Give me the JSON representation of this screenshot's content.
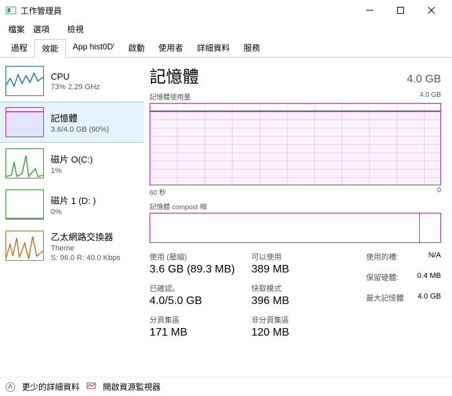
{
  "window": {
    "title": "工作管理員",
    "menu": {
      "file": "檔案",
      "options": "選項",
      "view": "檢視"
    }
  },
  "tabs": {
    "processes": "過程",
    "performance": "效能",
    "apphistory": "App hist0D'",
    "startup": "啟動",
    "users": "使用者",
    "details": "詳細資料",
    "services": "服務"
  },
  "sidebar": {
    "cpu": {
      "name": "CPU",
      "value": "73% 2.29 GHz"
    },
    "memory": {
      "name": "記憶體",
      "value": "3.6/4.0 GB (90%)"
    },
    "disk0": {
      "name": "磁片 O(C:)",
      "value": "1%"
    },
    "disk1": {
      "name": "磁片 1 (D: )",
      "value": "0%"
    },
    "eth": {
      "name": "乙太網路交換器",
      "sub": "Theme",
      "value": "S: 96.0 R: 40.0 Kbps"
    }
  },
  "main": {
    "title": "記憶體",
    "capacity": "4.0 GB",
    "chart1": {
      "label": "記憶體使用量",
      "max": "4.0 GB",
      "xleft": "60 秒",
      "xright": "0"
    },
    "chart2": {
      "label": "記憶體 compost 噸"
    },
    "stats": {
      "inuse_label": "使用 (壓縮)",
      "inuse_value": "3.6 GB (89.3 MB)",
      "available_label": "可以使用",
      "available_value": "389 MB",
      "committed_label": "已確認。",
      "committed_value": "4.0/5.0 GB",
      "cached_label": "快取模式",
      "cached_value": "396 MB",
      "paged_label": "分頁集區",
      "paged_value": "171 MB",
      "nonpaged_label": "非分頁集區",
      "nonpaged_value": "120 MB"
    },
    "right": {
      "slots_label": "使用的槽:",
      "slots_value": "N/A",
      "reserved_label": "保留硬體:",
      "reserved_value": "0.4 MB",
      "max_label": "最大記憶體",
      "max_value": "4.0 GB"
    }
  },
  "footer": {
    "fewer": "更少的詳細資料",
    "resmon": "開啟資源監視器"
  },
  "chart_data": {
    "type": "line",
    "title": "記憶體使用量",
    "xlabel": "秒",
    "ylabel": "GB",
    "x_range": [
      60,
      0
    ],
    "ylim": [
      0,
      4.0
    ],
    "series": [
      {
        "name": "記憶體",
        "values": [
          3.6,
          3.6,
          3.6,
          3.6,
          3.6,
          3.6,
          3.6,
          3.6,
          3.6,
          3.6,
          3.6,
          3.6,
          3.6,
          3.6,
          3.6,
          3.6,
          3.6,
          3.6,
          3.6,
          3.6
        ]
      }
    ]
  }
}
